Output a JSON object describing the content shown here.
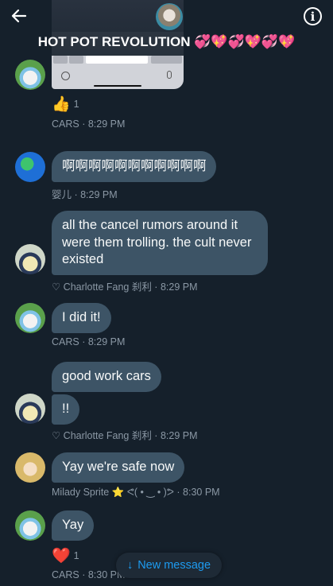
{
  "header": {
    "title": "HOT POT REVOLUTION",
    "title_emoji": "💞💖💞💖💞💖",
    "back_icon": "arrow-left-icon",
    "info_icon": "info-icon"
  },
  "messages": [
    {
      "type": "image",
      "reaction": {
        "emoji": "👍",
        "count": "1"
      },
      "meta": "CARS · 8:29 PM"
    },
    {
      "text": "啊啊啊啊啊啊啊啊啊啊啊",
      "meta": "婴儿 · 8:29 PM"
    },
    {
      "text": "all the cancel rumors around it were them trolling. the cult never existed",
      "meta": "♡ Charlotte Fang 刹利 · 8:29 PM"
    },
    {
      "text": "I did it!",
      "meta": "CARS · 8:29 PM"
    },
    {
      "text": "good work cars",
      "text2": "!!",
      "meta": "♡ Charlotte Fang 刹利 · 8:29 PM"
    },
    {
      "text": "Yay we're safe now",
      "meta": "Milady Sprite ⭐ ᕙ( • ‿ • )ᕗ · 8:30 PM"
    },
    {
      "text": "Yay",
      "reaction": {
        "emoji": "❤️",
        "count": "1"
      },
      "meta": "CARS · 8:30 PM"
    }
  ],
  "new_message": {
    "label": "New message",
    "icon": "arrow-down-icon"
  },
  "colors": {
    "background": "#15202b",
    "bubble": "#3d5466",
    "meta": "#8b98a5",
    "accent": "#1d9bf0"
  }
}
